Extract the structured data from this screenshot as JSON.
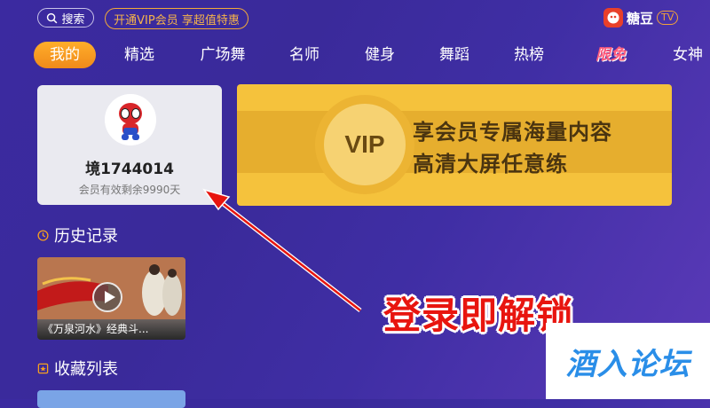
{
  "header": {
    "search_label": "搜索",
    "vip_promo": "开通VIP会员 享超值特惠",
    "logo_text": "糖豆",
    "logo_badge": "TV"
  },
  "nav": {
    "tabs": [
      {
        "label": "我的",
        "active": true
      },
      {
        "label": "精选"
      },
      {
        "label": "广场舞"
      },
      {
        "label": "名师"
      },
      {
        "label": "健身"
      },
      {
        "label": "舞蹈"
      },
      {
        "label": "热榜"
      },
      {
        "label": "限免"
      },
      {
        "label": "女神"
      }
    ]
  },
  "profile": {
    "username": "境1744014",
    "member_info": "会员有效剩余9990天"
  },
  "vip_banner": {
    "badge": "VIP",
    "line1": "享会员专属海量内容",
    "line2": "高清大屏任意练"
  },
  "sections": {
    "history_title": "历史记录",
    "favorites_title": "收藏列表"
  },
  "history_items": [
    {
      "caption": "《万泉河水》经典斗..."
    }
  ],
  "annotation": {
    "text": "登录即解锁"
  },
  "watermark": {
    "text": "酒入论坛"
  },
  "colors": {
    "background": "#3b2aa0",
    "accent_orange": "#f5a020",
    "vip_gold": "#f5c23c",
    "annotation_red": "#e8150f",
    "watermark_blue": "#2a8ee8"
  }
}
